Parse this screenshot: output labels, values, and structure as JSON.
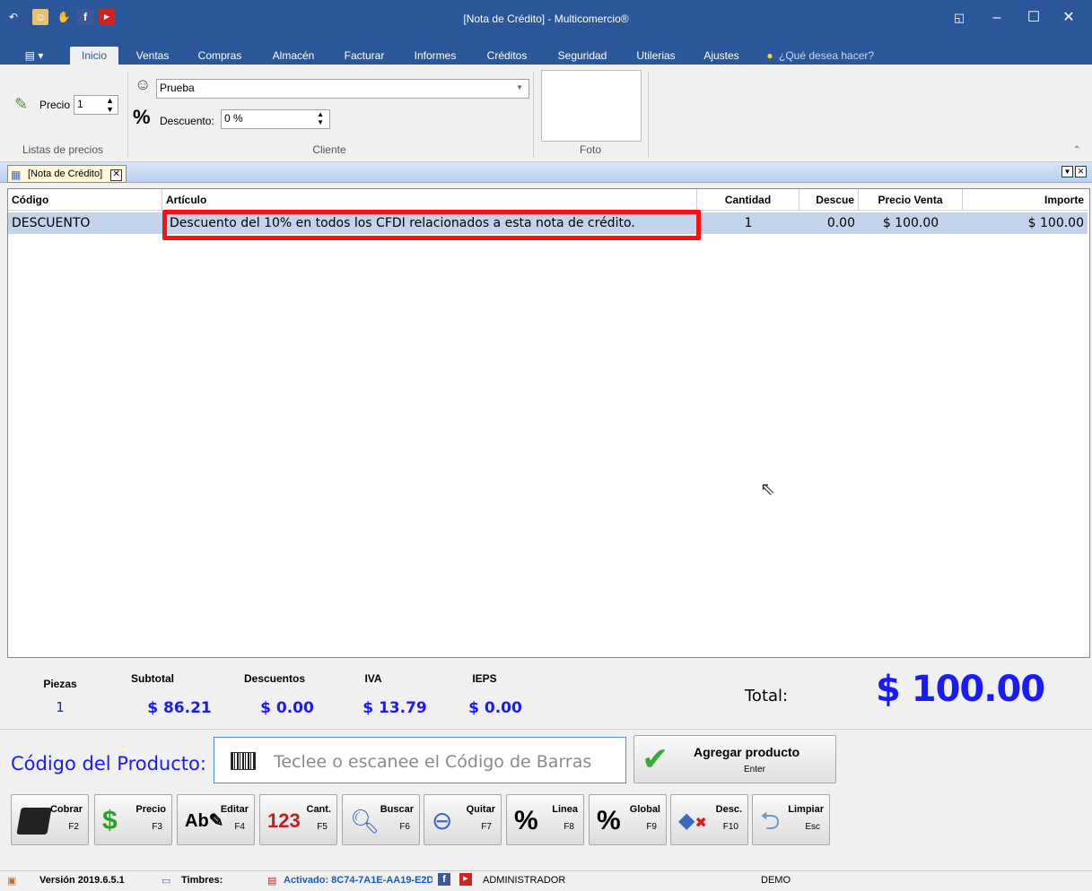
{
  "window": {
    "title": "[Nota de Crédito] - Multicomercio®",
    "restore_label": "◱",
    "minimize_label": "–",
    "maximize_label": "☐",
    "close_label": "✕"
  },
  "ribbon_tabs": [
    "Inicio",
    "Ventas",
    "Compras",
    "Almacén",
    "Facturar",
    "Informes",
    "Créditos",
    "Seguridad",
    "Utilerias",
    "Ajustes"
  ],
  "tell_me": "¿Qué desea hacer?",
  "ribbon": {
    "precio_label": "Precio",
    "precio_value": "1",
    "group_listas": "Listas de precios",
    "cliente_value": "Prueba",
    "descuento_label": "Descuento:",
    "descuento_value": "0 %",
    "group_cliente": "Cliente",
    "group_foto": "Foto"
  },
  "doc_tab": "[Nota de Crédito]",
  "grid": {
    "headers": [
      "Código",
      "Artículo",
      "Cantidad",
      "Descue",
      "Precio Venta",
      "Importe"
    ],
    "rows": [
      {
        "codigo": "DESCUENTO",
        "articulo": "Descuento del 10% en todos los CFDI relacionados a esta nota de crédito.",
        "cantidad": "1",
        "descuento": "0.00",
        "precio": "$ 100.00",
        "importe": "$ 100.00"
      }
    ]
  },
  "totals": {
    "piezas_label": "Piezas",
    "piezas": "1",
    "subtotal_label": "Subtotal",
    "subtotal": "$ 86.21",
    "descuentos_label": "Descuentos",
    "descuentos": "$ 0.00",
    "iva_label": "IVA",
    "iva": "$ 13.79",
    "ieps_label": "IEPS",
    "ieps": "$ 0.00",
    "total_label": "Total:",
    "total": "$ 100.00"
  },
  "product_code": {
    "label": "Código del Producto:",
    "placeholder": "Teclee o escanee el Código de Barras",
    "add_label": "Agregar producto",
    "add_key": "Enter"
  },
  "function_buttons": [
    {
      "label": "Cobrar",
      "key": "F2"
    },
    {
      "label": "Precio",
      "key": "F3"
    },
    {
      "label": "Editar",
      "key": "F4"
    },
    {
      "label": "Cant.",
      "key": "F5"
    },
    {
      "label": "Buscar",
      "key": "F6"
    },
    {
      "label": "Quitar",
      "key": "F7"
    },
    {
      "label": "Linea",
      "key": "F8"
    },
    {
      "label": "Global",
      "key": "F9"
    },
    {
      "label": "Desc.",
      "key": "F10"
    },
    {
      "label": "Limpiar",
      "key": "Esc"
    }
  ],
  "status": {
    "version": "Versión 2019.6.5.1",
    "timbres": "Timbres:",
    "activado": "Activado: 8C74-7A1E-AA19-E2D(",
    "user": "ADMINISTRADOR",
    "mode": "DEMO"
  },
  "colors": {
    "titlebar": "#2b579a",
    "accent_blue": "#1a1aff",
    "highlight": "#ff1010",
    "row_selected": "#c3d3ea"
  }
}
